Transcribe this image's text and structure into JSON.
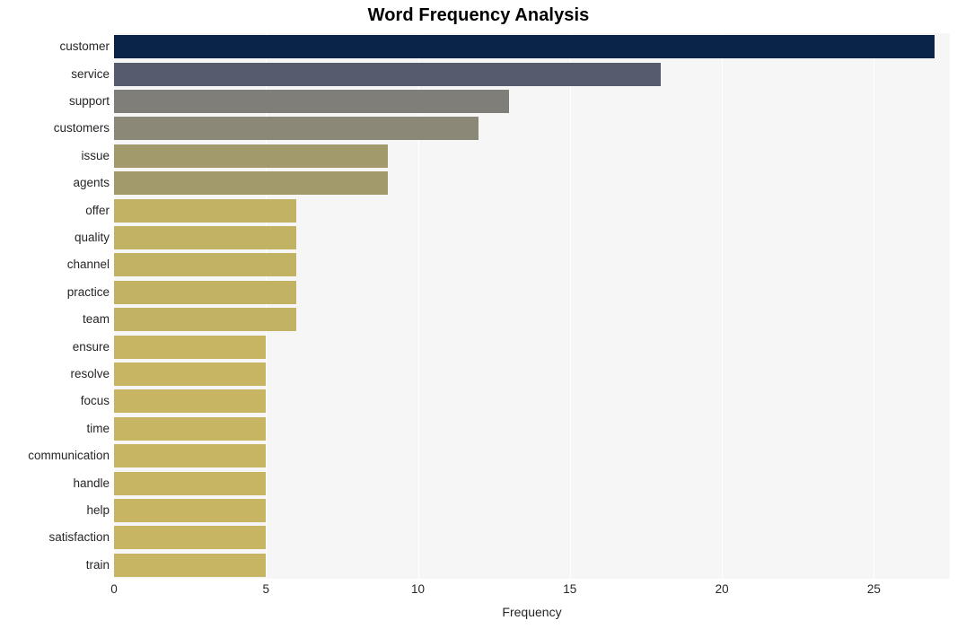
{
  "chart_data": {
    "type": "bar",
    "orientation": "horizontal",
    "title": "Word Frequency Analysis",
    "xlabel": "Frequency",
    "ylabel": "",
    "xlim": [
      0,
      27.5
    ],
    "ylim": null,
    "grid": true,
    "legend": null,
    "xticks": [
      0,
      5,
      10,
      15,
      20,
      25
    ],
    "xtick_labels": [
      "0",
      "5",
      "10",
      "15",
      "20",
      "25"
    ],
    "categories": [
      "customer",
      "service",
      "support",
      "customers",
      "issue",
      "agents",
      "offer",
      "quality",
      "channel",
      "practice",
      "team",
      "ensure",
      "resolve",
      "focus",
      "time",
      "communication",
      "handle",
      "help",
      "satisfaction",
      "train"
    ],
    "values": [
      27,
      18,
      13,
      12,
      9,
      9,
      6,
      6,
      6,
      6,
      6,
      5,
      5,
      5,
      5,
      5,
      5,
      5,
      5,
      5
    ],
    "bar_colors": [
      "#0a2349",
      "#565c6e",
      "#7f7e79",
      "#8b8877",
      "#a39a6c",
      "#a39a6c",
      "#c2b263",
      "#c2b263",
      "#c2b263",
      "#c2b263",
      "#c2b263",
      "#c8b564",
      "#c8b564",
      "#c8b564",
      "#c8b564",
      "#c8b564",
      "#c8b564",
      "#c8b564",
      "#c8b564",
      "#c8b564"
    ],
    "plot_background": "#f6f6f7",
    "gridline_color": "#ffffff",
    "figure_background": "#ffffff",
    "text_color": "#262626"
  }
}
